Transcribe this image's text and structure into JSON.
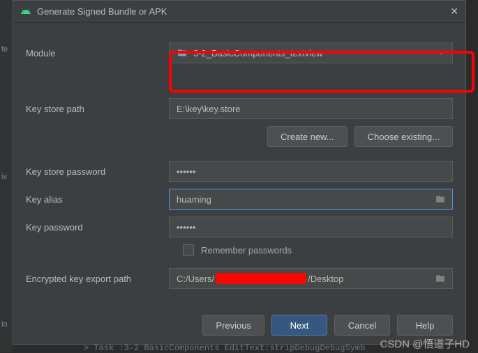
{
  "titlebar": {
    "title": "Generate Signed Bundle or APK"
  },
  "module": {
    "label": "Module",
    "value": "3-2_BasicComponents_textview"
  },
  "keystore": {
    "path_label": "Key store path",
    "path_value": "E:\\key\\key.store",
    "create_new": "Create new...",
    "choose_existing": "Choose existing...",
    "password_label": "Key store password",
    "password_value": "••••••"
  },
  "key": {
    "alias_label": "Key alias",
    "alias_value": "huaming",
    "password_label": "Key password",
    "password_value": "••••••"
  },
  "remember": {
    "label": "Remember passwords"
  },
  "export": {
    "label": "Encrypted key export path",
    "prefix": "C:/Users/",
    "suffix": "/Desktop"
  },
  "footer": {
    "previous": "Previous",
    "next": "Next",
    "cancel": "Cancel",
    "help": "Help"
  },
  "watermark": "CSDN @悟道子HD",
  "bg_text": "> Task :3-2 BasicComponents EditText:stripDebugDebugSymb"
}
